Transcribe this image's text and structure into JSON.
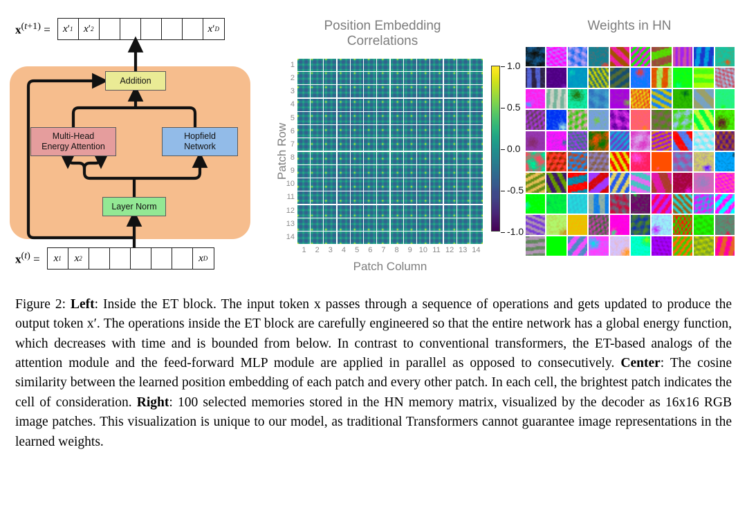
{
  "figure": {
    "left_panel": {
      "name": "ET block diagram",
      "output_token": {
        "label": "x(t+1) =",
        "cells": [
          "x'1",
          "x'2",
          "",
          "",
          "",
          "",
          "",
          "x'D"
        ]
      },
      "input_token": {
        "label": "x(t) =",
        "cells": [
          "x1",
          "x2",
          "",
          "",
          "",
          "",
          "",
          "xD"
        ]
      },
      "nodes": [
        {
          "id": "addition",
          "label": "Addition",
          "color": "#eaeb95"
        },
        {
          "id": "mhea",
          "label_line1": "Multi-Head",
          "label_line2": "Energy Attention",
          "color": "#e59d9d"
        },
        {
          "id": "hopfield",
          "label_line1": "Hopfield",
          "label_line2": "Network",
          "color": "#92bbe8"
        },
        {
          "id": "layernorm",
          "label": "Layer Norm",
          "color": "#93e894"
        }
      ],
      "block_background_color": "#f6bd8d"
    },
    "center_panel": {
      "title_line1": "Position Embedding",
      "title_line2": "Correlations",
      "xlabel": "Patch Column",
      "ylabel": "Patch Row",
      "xticks": [
        "1",
        "2",
        "3",
        "4",
        "5",
        "6",
        "7",
        "8",
        "9",
        "10",
        "11",
        "12",
        "13",
        "14"
      ],
      "yticks": [
        "1",
        "2",
        "3",
        "4",
        "5",
        "6",
        "7",
        "8",
        "9",
        "10",
        "11",
        "12",
        "13",
        "14"
      ],
      "colorbar_ticks": [
        "1.0",
        "0.5",
        "0.0",
        "-0.5",
        "-1.0"
      ],
      "colormap": "viridis",
      "title_color": "#7d7d7d",
      "tick_color": "#8a8a8a"
    },
    "right_panel": {
      "title": "Weights in HN",
      "grid_rows": 10,
      "grid_cols": 10,
      "title_color": "#7d7d7d"
    }
  },
  "chart_data": {
    "type": "heatmap",
    "title": "Position Embedding Correlations",
    "xlabel": "Patch Column",
    "ylabel": "Patch Row",
    "grid_rows": 14,
    "grid_cols": 14,
    "cell_rows": 14,
    "cell_cols": 14,
    "value_range": [
      -1.0,
      1.0
    ],
    "colorbar_ticks": [
      1.0,
      0.5,
      0.0,
      -0.5,
      -1.0
    ],
    "colormap": "viridis",
    "description": "Each of the 14x14 cells is itself a 14x14 cosine-similarity map between the position embedding of that patch and every other patch; the brightest spot marks the patch of consideration.",
    "xtick_labels": [
      "1",
      "2",
      "3",
      "4",
      "5",
      "6",
      "7",
      "8",
      "9",
      "10",
      "11",
      "12",
      "13",
      "14"
    ],
    "ytick_labels": [
      "1",
      "2",
      "3",
      "4",
      "5",
      "6",
      "7",
      "8",
      "9",
      "10",
      "11",
      "12",
      "13",
      "14"
    ]
  },
  "caption": {
    "figure_number": "Figure 2:",
    "left_bold": "Left",
    "left_text": ": Inside the ET block. The input token x passes through a sequence of operations and gets updated to produce the output token x′. The operations inside the ET block are carefully engineered so that the entire network has a global energy function, which decreases with time and is bounded from below. In contrast to conventional transformers, the ET-based analogs of the attention module and the feed-forward MLP module are applied in parallel as opposed to consecutively. ",
    "center_bold": "Center",
    "center_text": ": The cosine similarity between the learned position embedding of each patch and every other patch. In each cell, the brightest patch indicates the cell of consideration. ",
    "right_bold": "Right",
    "right_text": ": 100 selected memories stored in the HN memory matrix, visualized by the decoder as 16x16 RGB image patches. This visualization is unique to our model, as traditional Transformers cannot guarantee image representations in the learned weights."
  }
}
